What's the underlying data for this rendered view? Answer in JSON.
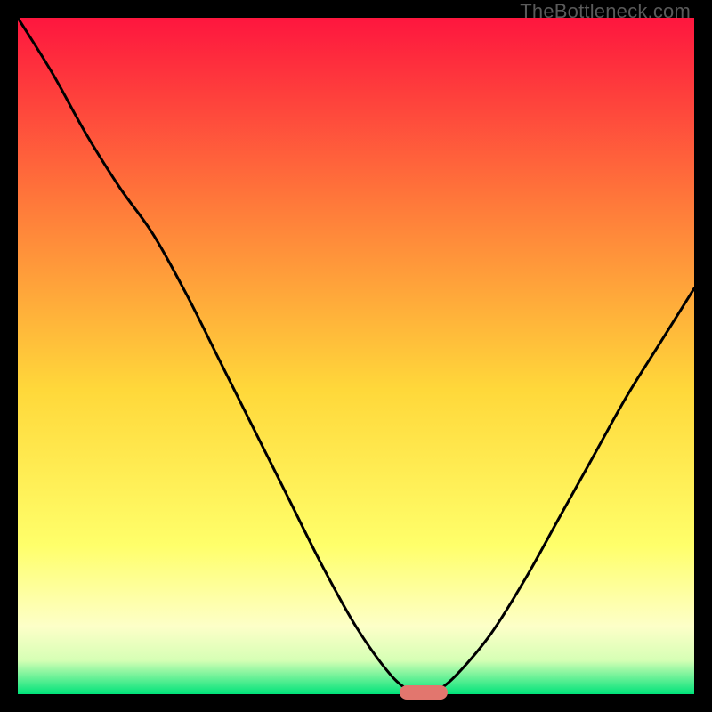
{
  "watermark": "TheBottleneck.com",
  "colors": {
    "background": "#000000",
    "gradient_top": "#fe163e",
    "gradient_mid1": "#ff7b3a",
    "gradient_mid2": "#ffd83a",
    "gradient_low1": "#ffff6a",
    "gradient_low2": "#fdffc8",
    "gradient_bottom": "#00e37a",
    "curve": "#000000",
    "marker": "#e2766e",
    "watermark_text": "#5a5a5a"
  },
  "chart_data": {
    "type": "line",
    "title": "",
    "xlabel": "",
    "ylabel": "",
    "xlim": [
      0,
      100
    ],
    "ylim": [
      0,
      100
    ],
    "x": [
      0,
      5,
      10,
      15,
      20,
      25,
      30,
      35,
      40,
      45,
      50,
      55,
      58,
      60,
      62,
      65,
      70,
      75,
      80,
      85,
      90,
      95,
      100
    ],
    "values": [
      100,
      92,
      83,
      75,
      68,
      59,
      49,
      39,
      29,
      19,
      10,
      3,
      0.5,
      0,
      0.5,
      3,
      9,
      17,
      26,
      35,
      44,
      52,
      60
    ],
    "minimum_x": 60,
    "minimum_y": 0,
    "marker": {
      "x": 60,
      "y": 0,
      "width_pct": 7,
      "height_pct": 2
    }
  }
}
